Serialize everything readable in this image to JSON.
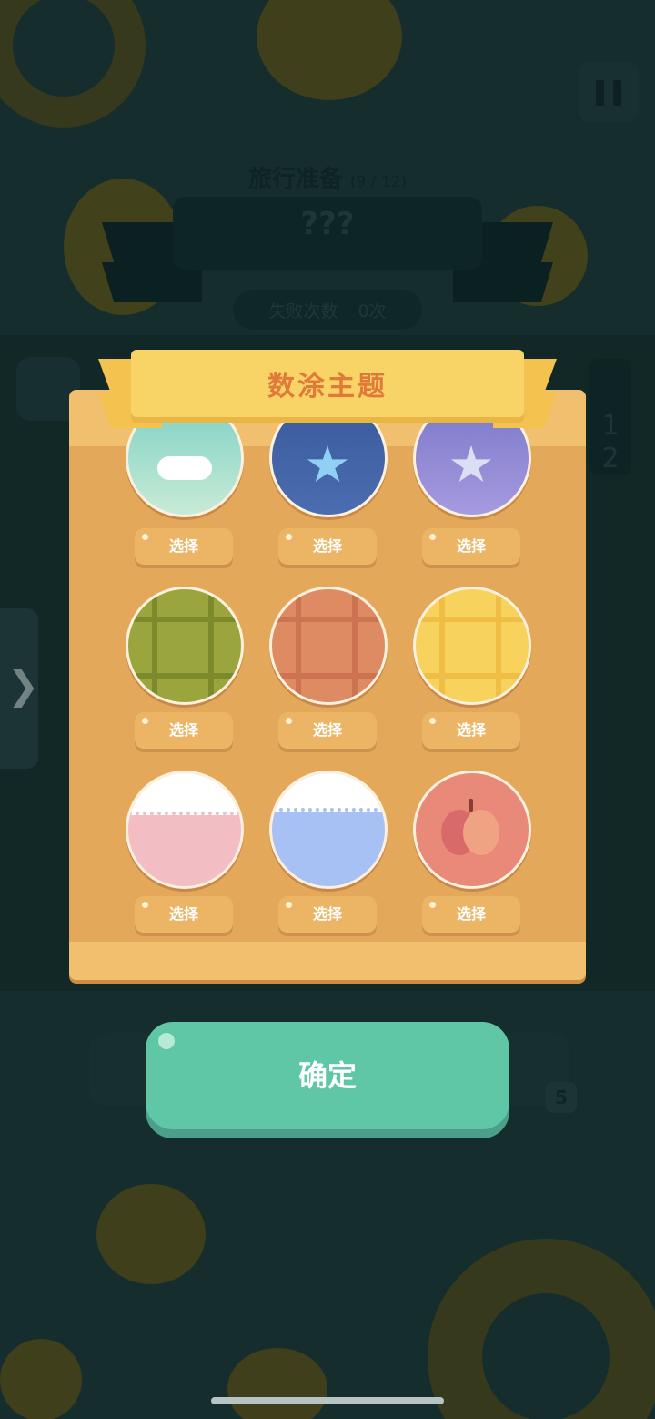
{
  "header": {
    "level_title": "旅行准备",
    "level_progress": "(9 / 12)",
    "puzzle_name": "???",
    "fail_label": "失败次数",
    "fail_count": "0次"
  },
  "board": {
    "column_clue": [
      "1",
      "2"
    ],
    "hint_count": "5"
  },
  "modal": {
    "title": "数涂主题",
    "pick_label": "选择",
    "themes": [
      {
        "name": "cloud-sky"
      },
      {
        "name": "blue-star"
      },
      {
        "name": "purple-star"
      },
      {
        "name": "green-waffle"
      },
      {
        "name": "orange-waffle"
      },
      {
        "name": "yellow-waffle"
      },
      {
        "name": "pink-lace"
      },
      {
        "name": "blue-lace"
      },
      {
        "name": "apple"
      }
    ]
  },
  "confirm_label": "确定",
  "colors": {
    "background": "#1f3a3b",
    "modal": "#e4a85a",
    "banner": "#f8d467",
    "title_text": "#e07a3a",
    "confirm": "#5fc7a6"
  }
}
